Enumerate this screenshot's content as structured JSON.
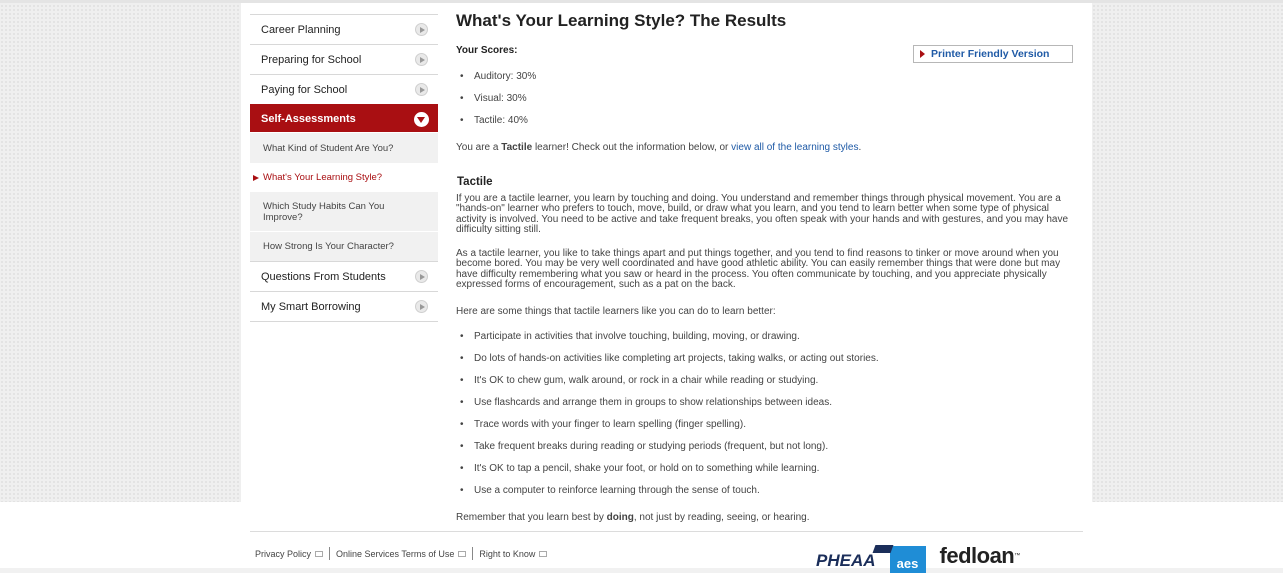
{
  "sidebar": {
    "items_top": [
      "Career Planning",
      "Preparing for School",
      "Paying for School"
    ],
    "active": "Self-Assessments",
    "sub_items": [
      "What Kind of Student Are You?",
      "What's Your Learning Style?",
      "Which Study Habits Can You Improve?",
      "How Strong Is Your Character?"
    ],
    "items_bottom": [
      "Questions From Students",
      "My Smart Borrowing"
    ]
  },
  "main": {
    "title": "What's Your Learning Style? The Results",
    "scores_heading": "Your Scores:",
    "printer_label": "Printer Friendly Version",
    "scores": [
      "Auditory: 30%",
      "Visual: 30%",
      "Tactile: 40%"
    ],
    "result_prefix": "You are a ",
    "result_type": "Tactile",
    "result_mid": " learner! Check out the information below, or ",
    "result_link": "view all of the learning styles",
    "result_end": ".",
    "section_title": "Tactile",
    "para1": "If you are a tactile learner, you learn by touching and doing. You understand and remember things through physical movement. You are a \"hands-on\" learner who prefers to touch, move, build, or draw what you learn, and you tend to learn better when some type of physical activity is involved. You need to be active and take frequent breaks, you often speak with your hands and with gestures, and you may have difficulty sitting still.",
    "para2": "As a tactile learner, you like to take things apart and put things together, and you tend to find reasons to tinker or move around when you become bored. You may be very well coordinated and have good athletic ability. You can easily remember things that were done but may have difficulty remembering what you saw or heard in the process. You often communicate by touching, and you appreciate physically expressed forms of encouragement, such as a pat on the back.",
    "tips_intro": "Here are some things that tactile learners like you can do to learn better:",
    "tips": [
      "Participate in activities that involve touching, building, moving, or drawing.",
      "Do lots of hands-on activities like completing art projects, taking walks, or acting out stories.",
      "It's OK to chew gum, walk around, or rock in a chair while reading or studying.",
      "Use flashcards and arrange them in groups to show relationships between ideas.",
      "Trace words with your finger to learn spelling (finger spelling).",
      "Take frequent breaks during reading or studying periods (frequent, but not long).",
      "It's OK to tap a pencil, shake your foot, or hold on to something while learning.",
      "Use a computer to reinforce learning through the sense of touch."
    ],
    "closing_prefix": "Remember that you learn best by ",
    "closing_bold": "doing",
    "closing_end": ", not just by reading, seeing, or hearing."
  },
  "footer": {
    "links": [
      "Privacy Policy",
      "Online Services Terms of Use",
      "Right to Know"
    ],
    "logos": [
      "PHEAA",
      "aes",
      "fedloan"
    ]
  },
  "colors": {
    "accent_red": "#a90f12",
    "link_blue": "#1f5aa6"
  }
}
